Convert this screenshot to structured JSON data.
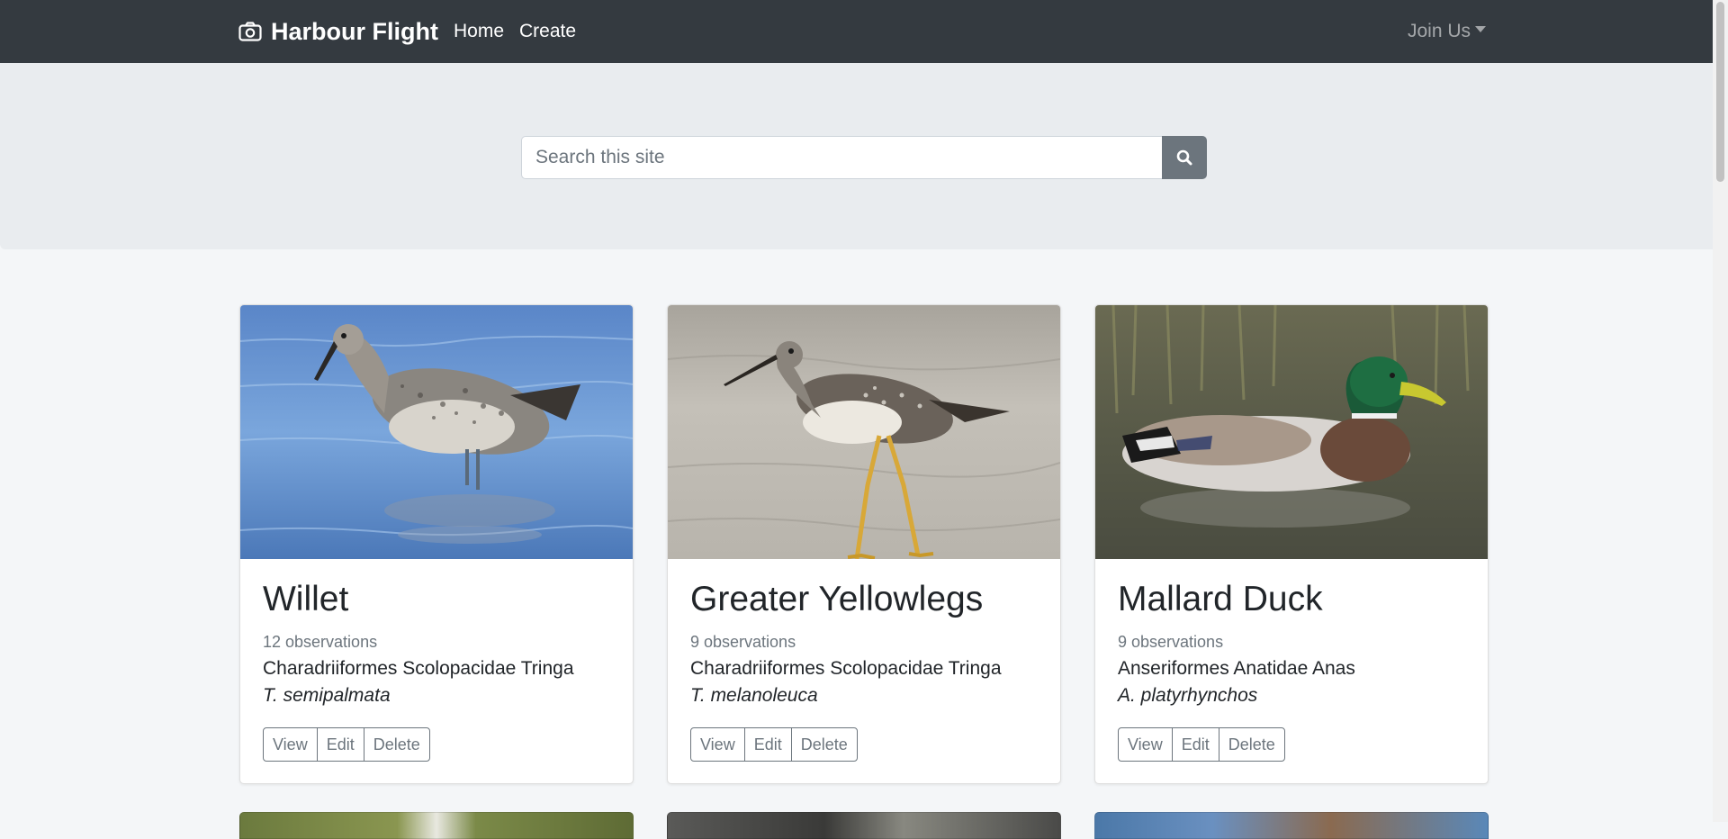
{
  "navbar": {
    "brand": "Harbour Flight",
    "links": {
      "home": "Home",
      "create": "Create",
      "join": "Join Us"
    }
  },
  "search": {
    "placeholder": "Search this site"
  },
  "cards": [
    {
      "title": "Willet",
      "observations": "12 observations",
      "taxonomy": "Charadriiformes Scolopacidae Tringa",
      "scientific": "T. semipalmata",
      "image": "willet-photo"
    },
    {
      "title": "Greater Yellowlegs",
      "observations": "9 observations",
      "taxonomy": "Charadriiformes Scolopacidae Tringa",
      "scientific": "T. melanoleuca",
      "image": "greater-yellowlegs-photo"
    },
    {
      "title": "Mallard Duck",
      "observations": "9 observations",
      "taxonomy": "Anseriformes Anatidae Anas",
      "scientific": "A. platyrhynchos",
      "image": "mallard-duck-photo"
    }
  ],
  "buttons": {
    "view": "View",
    "edit": "Edit",
    "delete": "Delete"
  },
  "colors": {
    "navbar": "#343a40",
    "hero": "#e9ecef",
    "search_button": "#6c757d"
  }
}
